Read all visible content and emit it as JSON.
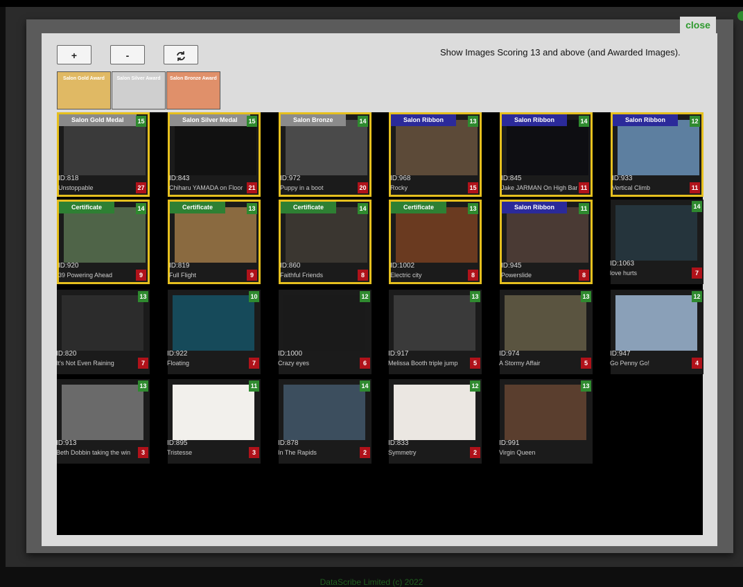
{
  "close_label": "close",
  "toolbar": {
    "zoom_in": "+",
    "zoom_out": "-",
    "refresh_icon": "refresh-icon"
  },
  "filter_text": "Show Images Scoring 13 and above (and Awarded Images).",
  "legend": [
    {
      "label": "Salon Gold Award",
      "color": "#e0b964"
    },
    {
      "label": "Salon Silver Award",
      "color": "#cfcfcf"
    },
    {
      "label": "Salon Bronze Award",
      "color": "#e0906a"
    }
  ],
  "cards": [
    {
      "award": "Salon Gold Medal",
      "score": "15",
      "id": "ID:818",
      "title": "Unstoppable",
      "rank": "27",
      "thumb": "#3a3a3a"
    },
    {
      "award": "Salon Silver Medal",
      "score": "15",
      "id": "ID:843",
      "title": "Chiharu YAMADA on Floor",
      "rank": "21",
      "thumb": "#111111"
    },
    {
      "award": "Salon Bronze",
      "score": "14",
      "id": "ID:972",
      "title": "Puppy in a boot",
      "rank": "20",
      "thumb": "#4a4a4a"
    },
    {
      "award": "Salon Ribbon",
      "score": "13",
      "id": "ID:968",
      "title": "Rocky",
      "rank": "15",
      "thumb": "#5c4a38"
    },
    {
      "award": "Salon Ribbon",
      "score": "14",
      "id": "ID:845",
      "title": "Jake JARMAN On High Bar",
      "rank": "11",
      "thumb": "#0e0e12"
    },
    {
      "award": "Salon Ribbon",
      "score": "12",
      "id": "ID:933",
      "title": "Vertical Climb",
      "rank": "11",
      "thumb": "#5d7fa0"
    },
    {
      "award": "Certificate",
      "score": "14",
      "id": "ID:920",
      "title": "39 Powering Ahead",
      "rank": "9",
      "thumb": "#4f6448"
    },
    {
      "award": "Certificate",
      "score": "13",
      "id": "ID:819",
      "title": "Full Flight",
      "rank": "9",
      "thumb": "#8a6a40"
    },
    {
      "award": "Certificate",
      "score": "14",
      "id": "ID:860",
      "title": "Faithful Friends",
      "rank": "8",
      "thumb": "#3a3630"
    },
    {
      "award": "Certificate",
      "score": "13",
      "id": "ID:1002",
      "title": "Electric city",
      "rank": "8",
      "thumb": "#6a3a20"
    },
    {
      "award": "Salon Ribbon",
      "score": "11",
      "id": "ID:945",
      "title": "Powerslide",
      "rank": "8",
      "thumb": "#4a3a34"
    },
    {
      "award": "",
      "score": "14",
      "id": "ID:1063",
      "title": "love hurts",
      "rank": "7",
      "thumb": "#25343c"
    },
    {
      "award": "",
      "score": "13",
      "id": "ID:820",
      "title": "It's Not Even Raining",
      "rank": "7",
      "thumb": "#2c2c2c"
    },
    {
      "award": "",
      "score": "10",
      "id": "ID:922",
      "title": "Floating",
      "rank": "7",
      "thumb": "#164a5a"
    },
    {
      "award": "",
      "score": "12",
      "id": "ID:1000",
      "title": "Crazy eyes",
      "rank": "6",
      "thumb": "#1a1a1a"
    },
    {
      "award": "",
      "score": "13",
      "id": "ID:917",
      "title": "Melissa Booth triple jump",
      "rank": "5",
      "thumb": "#3a3a3a"
    },
    {
      "award": "",
      "score": "13",
      "id": "ID:974",
      "title": "A Stormy Affair",
      "rank": "5",
      "thumb": "#5a5440"
    },
    {
      "award": "",
      "score": "12",
      "id": "ID:947",
      "title": "Go Penny Go!",
      "rank": "4",
      "thumb": "#8aa0b8"
    },
    {
      "award": "",
      "score": "13",
      "id": "ID:913",
      "title": "Beth Dobbin taking the win",
      "rank": "3",
      "thumb": "#6a6a6a"
    },
    {
      "award": "",
      "score": "11",
      "id": "ID:895",
      "title": "Tristesse",
      "rank": "3",
      "thumb": "#f2f0ec"
    },
    {
      "award": "",
      "score": "14",
      "id": "ID:878",
      "title": "In The Rapids",
      "rank": "2",
      "thumb": "#3c4e5e"
    },
    {
      "award": "",
      "score": "12",
      "id": "ID:833",
      "title": "Symmetry",
      "rank": "2",
      "thumb": "#ebe7e2"
    },
    {
      "award": "",
      "score": "13",
      "id": "ID:991",
      "title": "Virgin Queen",
      "rank": "",
      "thumb": "#5a3e2e"
    }
  ],
  "footer": "DataScribe Limited (c) 2022"
}
